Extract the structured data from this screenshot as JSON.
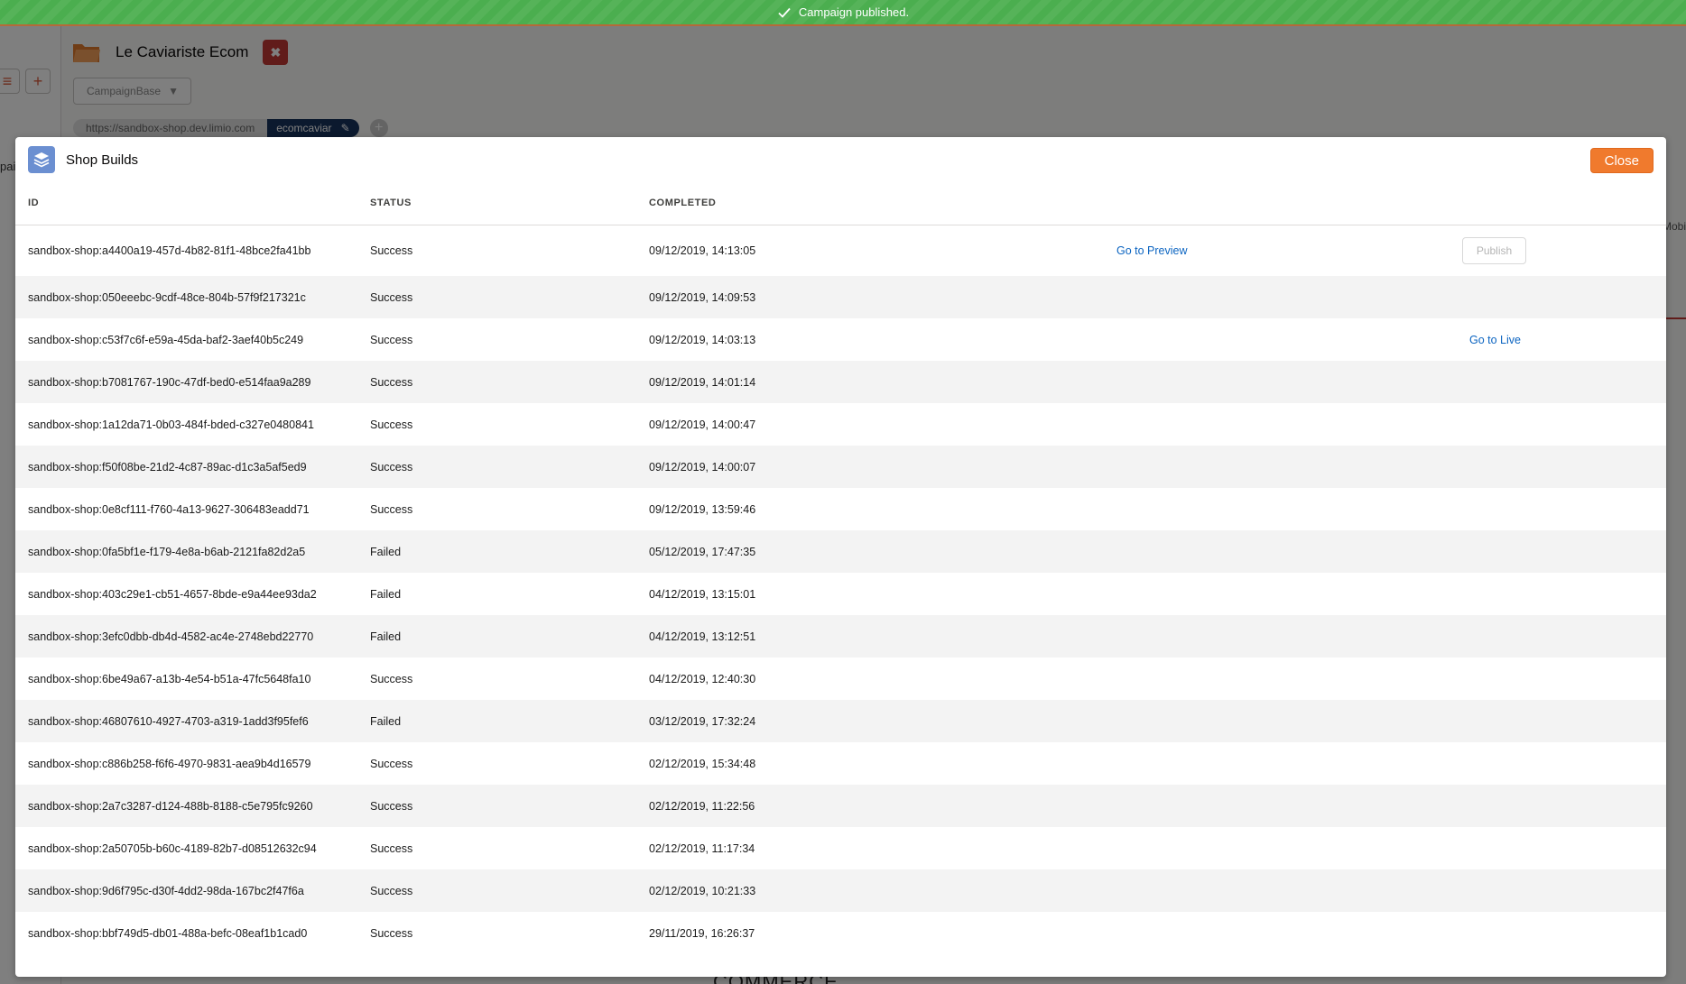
{
  "toast": {
    "message": "Campaign published."
  },
  "background": {
    "left_partial_text": "pai",
    "app_title": "Le Caviariste Ecom",
    "dropdown_label": "CampaignBase",
    "url_base": "https://sandbox-shop.dev.limio.com",
    "url_path": "ecomcaviar",
    "right_partial_text": "Mobi",
    "bottom_partial_text": "COMMERCE"
  },
  "modal": {
    "title": "Shop Builds",
    "close_label": "Close",
    "columns": {
      "id": "ID",
      "status": "STATUS",
      "completed": "COMPLETED"
    },
    "rows": [
      {
        "id": "sandbox-shop:a4400a19-457d-4b82-81f1-48bce2fa41bb",
        "status": "Success",
        "completed": "09/12/2019, 14:13:05",
        "action": "Go to Preview",
        "publish": "Publish"
      },
      {
        "id": "sandbox-shop:050eeebc-9cdf-48ce-804b-57f9f217321c",
        "status": "Success",
        "completed": "09/12/2019, 14:09:53",
        "action": "",
        "publish": ""
      },
      {
        "id": "sandbox-shop:c53f7c6f-e59a-45da-baf2-3aef40b5c249",
        "status": "Success",
        "completed": "09/12/2019, 14:03:13",
        "action": "",
        "publish": "Go to Live"
      },
      {
        "id": "sandbox-shop:b7081767-190c-47df-bed0-e514faa9a289",
        "status": "Success",
        "completed": "09/12/2019, 14:01:14",
        "action": "",
        "publish": ""
      },
      {
        "id": "sandbox-shop:1a12da71-0b03-484f-bded-c327e0480841",
        "status": "Success",
        "completed": "09/12/2019, 14:00:47",
        "action": "",
        "publish": ""
      },
      {
        "id": "sandbox-shop:f50f08be-21d2-4c87-89ac-d1c3a5af5ed9",
        "status": "Success",
        "completed": "09/12/2019, 14:00:07",
        "action": "",
        "publish": ""
      },
      {
        "id": "sandbox-shop:0e8cf111-f760-4a13-9627-306483eadd71",
        "status": "Success",
        "completed": "09/12/2019, 13:59:46",
        "action": "",
        "publish": ""
      },
      {
        "id": "sandbox-shop:0fa5bf1e-f179-4e8a-b6ab-2121fa82d2a5",
        "status": "Failed",
        "completed": "05/12/2019, 17:47:35",
        "action": "",
        "publish": ""
      },
      {
        "id": "sandbox-shop:403c29e1-cb51-4657-8bde-e9a44ee93da2",
        "status": "Failed",
        "completed": "04/12/2019, 13:15:01",
        "action": "",
        "publish": ""
      },
      {
        "id": "sandbox-shop:3efc0dbb-db4d-4582-ac4e-2748ebd22770",
        "status": "Failed",
        "completed": "04/12/2019, 13:12:51",
        "action": "",
        "publish": ""
      },
      {
        "id": "sandbox-shop:6be49a67-a13b-4e54-b51a-47fc5648fa10",
        "status": "Success",
        "completed": "04/12/2019, 12:40:30",
        "action": "",
        "publish": ""
      },
      {
        "id": "sandbox-shop:46807610-4927-4703-a319-1add3f95fef6",
        "status": "Failed",
        "completed": "03/12/2019, 17:32:24",
        "action": "",
        "publish": ""
      },
      {
        "id": "sandbox-shop:c886b258-f6f6-4970-9831-aea9b4d16579",
        "status": "Success",
        "completed": "02/12/2019, 15:34:48",
        "action": "",
        "publish": ""
      },
      {
        "id": "sandbox-shop:2a7c3287-d124-488b-8188-c5e795fc9260",
        "status": "Success",
        "completed": "02/12/2019, 11:22:56",
        "action": "",
        "publish": ""
      },
      {
        "id": "sandbox-shop:2a50705b-b60c-4189-82b7-d08512632c94",
        "status": "Success",
        "completed": "02/12/2019, 11:17:34",
        "action": "",
        "publish": ""
      },
      {
        "id": "sandbox-shop:9d6f795c-d30f-4dd2-98da-167bc2f47f6a",
        "status": "Success",
        "completed": "02/12/2019, 10:21:33",
        "action": "",
        "publish": ""
      },
      {
        "id": "sandbox-shop:bbf749d5-db01-488a-befc-08eaf1b1cad0",
        "status": "Success",
        "completed": "29/11/2019, 16:26:37",
        "action": "",
        "publish": ""
      }
    ]
  },
  "colors": {
    "toast": "#4bae4f",
    "close_button": "#f07a2d",
    "link": "#0b64c1",
    "modal_icon": "#6b8fd1"
  }
}
